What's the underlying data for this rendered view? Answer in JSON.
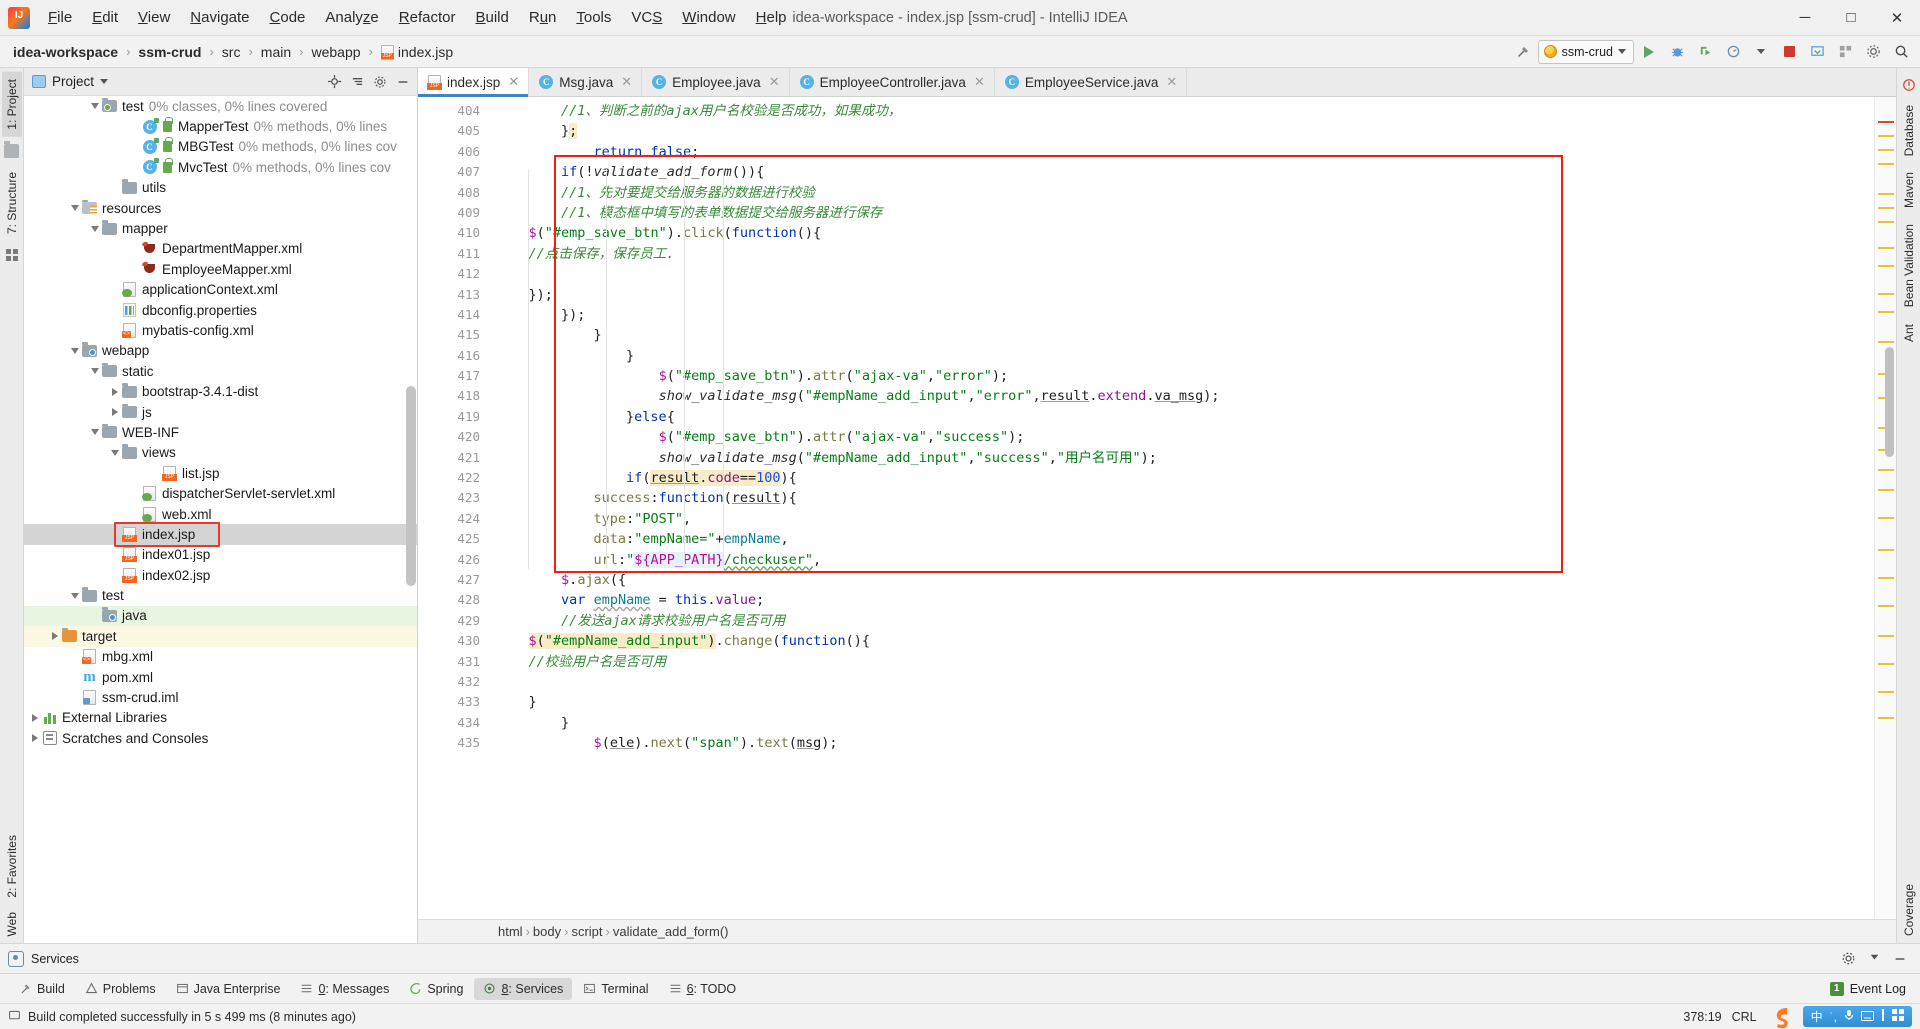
{
  "window": {
    "title": "idea-workspace - index.jsp [ssm-crud] - IntelliJ IDEA",
    "minimize": "─",
    "maximize": "□",
    "close": "✕"
  },
  "menubar": [
    {
      "label": "File",
      "mnemonic": "F"
    },
    {
      "label": "Edit",
      "mnemonic": "E"
    },
    {
      "label": "View",
      "mnemonic": "V"
    },
    {
      "label": "Navigate",
      "mnemonic": "N"
    },
    {
      "label": "Code",
      "mnemonic": "C"
    },
    {
      "label": "Analyze",
      "mnemonic": "z"
    },
    {
      "label": "Refactor",
      "mnemonic": "R"
    },
    {
      "label": "Build",
      "mnemonic": "B"
    },
    {
      "label": "Run",
      "mnemonic": "u"
    },
    {
      "label": "Tools",
      "mnemonic": "T"
    },
    {
      "label": "VCS",
      "mnemonic": "S"
    },
    {
      "label": "Window",
      "mnemonic": "W"
    },
    {
      "label": "Help",
      "mnemonic": "H"
    }
  ],
  "breadcrumbs": [
    {
      "label": "idea-workspace",
      "bold": true
    },
    {
      "label": "ssm-crud",
      "bold": true
    },
    {
      "label": "src",
      "bold": false
    },
    {
      "label": "main",
      "bold": false
    },
    {
      "label": "webapp",
      "bold": false
    },
    {
      "label": "index.jsp",
      "bold": false,
      "icon": "jsp-file-icon"
    }
  ],
  "toolbar": {
    "build_icon": "hammer-icon",
    "run_config": "ssm-crud",
    "run_label": "run-icon",
    "debug_label": "debug-icon",
    "coverage_label": "coverage-icon",
    "profile_label": "profile-icon",
    "stop_label": "stop-icon",
    "update_label": "update-icon",
    "search_label": "search-icon",
    "settings_label": "settings-icon"
  },
  "left_strip": [
    {
      "label": "1: Project",
      "mnemonic": "1",
      "active": true
    },
    {
      "label": "7: Structure",
      "mnemonic": "7",
      "active": false
    }
  ],
  "left_strip_bottom": [
    {
      "label": "2: Favorites",
      "mnemonic": "2"
    },
    {
      "label": "Web",
      "mnemonic": ""
    }
  ],
  "right_strip": [
    {
      "label": "Database"
    },
    {
      "label": "Maven"
    },
    {
      "label": "Bean Validation"
    },
    {
      "label": "Ant"
    },
    {
      "label": "Coverage"
    }
  ],
  "project_panel": {
    "title": "Project",
    "chevron": "▾",
    "icons": [
      "locate-icon",
      "collapse-all-icon",
      "settings-icon",
      "hide-icon"
    ],
    "tree": [
      {
        "indent": 3,
        "arrow": "down",
        "icon": "folder-test",
        "label": "test",
        "dim": "0% classes, 0% lines covered"
      },
      {
        "indent": 5,
        "arrow": "none",
        "icon": "java-class",
        "label": "MapperTest",
        "dim": "0% methods, 0% lines",
        "lock": true
      },
      {
        "indent": 5,
        "arrow": "none",
        "icon": "java-class",
        "label": "MBGTest",
        "dim": "0% methods, 0% lines cov",
        "lock": true
      },
      {
        "indent": 5,
        "arrow": "none",
        "icon": "java-class",
        "label": "MvcTest",
        "dim": "0% methods, 0% lines cov",
        "lock": true
      },
      {
        "indent": 4,
        "arrow": "none",
        "icon": "folder",
        "label": "utils",
        "dim": ""
      },
      {
        "indent": 2,
        "arrow": "down",
        "icon": "folder-res",
        "label": "resources",
        "dim": ""
      },
      {
        "indent": 3,
        "arrow": "down",
        "icon": "folder",
        "label": "mapper",
        "dim": ""
      },
      {
        "indent": 5,
        "arrow": "none",
        "icon": "mybatis",
        "label": "DepartmentMapper.xml",
        "dim": ""
      },
      {
        "indent": 5,
        "arrow": "none",
        "icon": "mybatis",
        "label": "EmployeeMapper.xml",
        "dim": ""
      },
      {
        "indent": 4,
        "arrow": "none",
        "icon": "xml-spring",
        "label": "applicationContext.xml",
        "dim": ""
      },
      {
        "indent": 4,
        "arrow": "none",
        "icon": "props",
        "label": "dbconfig.properties",
        "dim": ""
      },
      {
        "indent": 4,
        "arrow": "none",
        "icon": "xml",
        "label": "mybatis-config.xml",
        "dim": ""
      },
      {
        "indent": 2,
        "arrow": "down",
        "icon": "folder-web",
        "label": "webapp",
        "dim": ""
      },
      {
        "indent": 3,
        "arrow": "down",
        "icon": "folder",
        "label": "static",
        "dim": ""
      },
      {
        "indent": 4,
        "arrow": "right",
        "icon": "folder",
        "label": "bootstrap-3.4.1-dist",
        "dim": ""
      },
      {
        "indent": 4,
        "arrow": "right",
        "icon": "folder",
        "label": "js",
        "dim": ""
      },
      {
        "indent": 3,
        "arrow": "down",
        "icon": "folder",
        "label": "WEB-INF",
        "dim": ""
      },
      {
        "indent": 4,
        "arrow": "down",
        "icon": "folder",
        "label": "views",
        "dim": ""
      },
      {
        "indent": 6,
        "arrow": "none",
        "icon": "jsp",
        "label": "list.jsp",
        "dim": ""
      },
      {
        "indent": 5,
        "arrow": "none",
        "icon": "xml-spring",
        "label": "dispatcherServlet-servlet.xml",
        "dim": ""
      },
      {
        "indent": 5,
        "arrow": "none",
        "icon": "xml-spring",
        "label": "web.xml",
        "dim": ""
      },
      {
        "indent": 4,
        "arrow": "none",
        "icon": "jsp",
        "label": "index.jsp",
        "dim": "",
        "selected": true,
        "boxed": true
      },
      {
        "indent": 4,
        "arrow": "none",
        "icon": "jsp",
        "label": "index01.jsp",
        "dim": ""
      },
      {
        "indent": 4,
        "arrow": "none",
        "icon": "jsp",
        "label": "index02.jsp",
        "dim": ""
      },
      {
        "indent": 2,
        "arrow": "down",
        "icon": "folder",
        "label": "test",
        "dim": ""
      },
      {
        "indent": 3,
        "arrow": "none",
        "icon": "folder-src",
        "label": "java",
        "dim": "",
        "greenbg": true
      },
      {
        "indent": 1,
        "arrow": "right",
        "icon": "folder-orange",
        "label": "target",
        "dim": "",
        "yellowbg": true
      },
      {
        "indent": 2,
        "arrow": "none",
        "icon": "xml",
        "label": "mbg.xml",
        "dim": ""
      },
      {
        "indent": 2,
        "arrow": "none",
        "icon": "maven",
        "label": "pom.xml",
        "dim": ""
      },
      {
        "indent": 2,
        "arrow": "none",
        "icon": "iml",
        "label": "ssm-crud.iml",
        "dim": ""
      },
      {
        "indent": 0,
        "arrow": "right",
        "icon": "libs",
        "label": "External Libraries",
        "dim": ""
      },
      {
        "indent": 0,
        "arrow": "right",
        "icon": "scratch",
        "label": "Scratches and Consoles",
        "dim": ""
      }
    ]
  },
  "editor": {
    "tabs": [
      {
        "label": "index.jsp",
        "icon": "jsp-file-icon",
        "active": true
      },
      {
        "label": "Msg.java",
        "icon": "java-class-icon",
        "active": false
      },
      {
        "label": "Employee.java",
        "icon": "java-class-icon",
        "active": false
      },
      {
        "label": "EmployeeController.java",
        "icon": "java-class-icon",
        "active": false
      },
      {
        "label": "EmployeeService.java",
        "icon": "java-class-icon",
        "active": false
      }
    ],
    "first_line": 404,
    "lines": [
      {
        "n": 404,
        "fold": "none"
      },
      {
        "n": 405,
        "fold": "end"
      },
      {
        "n": 406,
        "fold": "end"
      },
      {
        "n": 407,
        "fold": "none"
      },
      {
        "n": 408,
        "fold": "none"
      },
      {
        "n": 409,
        "fold": "open"
      },
      {
        "n": 410,
        "fold": "none"
      },
      {
        "n": 411,
        "fold": "none"
      },
      {
        "n": 412,
        "fold": "open"
      },
      {
        "n": 413,
        "fold": "none"
      },
      {
        "n": 414,
        "fold": "none"
      },
      {
        "n": 415,
        "fold": "none"
      },
      {
        "n": 416,
        "fold": "open"
      },
      {
        "n": 417,
        "fold": "open"
      },
      {
        "n": 418,
        "fold": "none"
      },
      {
        "n": 419,
        "fold": "none"
      },
      {
        "n": 420,
        "fold": "end"
      },
      {
        "n": 421,
        "fold": "none"
      },
      {
        "n": 422,
        "fold": "none"
      },
      {
        "n": 423,
        "fold": "end"
      },
      {
        "n": 424,
        "fold": "end"
      },
      {
        "n": 425,
        "fold": "end"
      },
      {
        "n": 426,
        "fold": "end"
      },
      {
        "n": 427,
        "fold": "none"
      },
      {
        "n": 428,
        "fold": "none"
      },
      {
        "n": 429,
        "fold": "open"
      },
      {
        "n": 430,
        "fold": "open"
      },
      {
        "n": 431,
        "fold": "end"
      },
      {
        "n": 432,
        "fold": "open"
      },
      {
        "n": 433,
        "fold": "none"
      },
      {
        "n": 434,
        "fold": "none"
      },
      {
        "n": 435,
        "fold": "none"
      }
    ],
    "code_text": [
      "            $(ele).next(\"span\").text(msg);",
      "        }",
      "    }",
      "",
      "    //校验用户名是否可用",
      "    $(\"#empName_add_input\").change(function(){",
      "        //发送ajax请求校验用户名是否可用",
      "        var empName = this.value;",
      "        $.ajax({",
      "            url:\"${APP_PATH}/checkuser\",",
      "            data:\"empName=\"+empName,",
      "            type:\"POST\",",
      "            success:function(result){",
      "                if(result.code==100){",
      "                    show_validate_msg(\"#empName_add_input\",\"success\",\"用户名可用\");",
      "                    $(\"#emp_save_btn\").attr(\"ajax-va\",\"success\");",
      "                }else{",
      "                    show_validate_msg(\"#empName_add_input\",\"error\",result.extend.va_msg);",
      "                    $(\"#emp_save_btn\").attr(\"ajax-va\",\"error\");",
      "                }",
      "            }",
      "        });",
      "    });",
      "",
      "    //点击保存，保存员工.",
      "    $(\"#emp_save_btn\").click(function(){",
      "        //1、模态框中填写的表单数据提交给服务器进行保存",
      "        //1、先对要提交给服务器的数据进行校验",
      "        if(!validate_add_form()){",
      "            return false;",
      "        };",
      "        //1、判断之前的ajax用户名校验是否成功，如果成功，"
    ],
    "annotation_box_color": "#f01f12",
    "breadcrumb_path": [
      "html",
      "body",
      "script",
      "validate_add_form()"
    ]
  },
  "bottom": {
    "services_label": "Services",
    "tool_tabs": [
      {
        "label": "Build",
        "icon": "hammer-icon",
        "mnemonic": "",
        "active": false
      },
      {
        "label": "Problems",
        "icon": "warning-icon",
        "mnemonic": "",
        "active": false
      },
      {
        "label": "Java Enterprise",
        "icon": "java-ee-icon",
        "mnemonic": "",
        "active": false
      },
      {
        "label": "0: Messages",
        "icon": "list-icon",
        "mnemonic": "0",
        "active": false
      },
      {
        "label": "Spring",
        "icon": "spring-icon",
        "mnemonic": "",
        "active": false
      },
      {
        "label": "8: Services",
        "icon": "services-icon",
        "mnemonic": "8",
        "active": true
      },
      {
        "label": "Terminal",
        "icon": "terminal-icon",
        "mnemonic": "",
        "active": false
      },
      {
        "label": "6: TODO",
        "icon": "list-icon",
        "mnemonic": "6",
        "active": false
      }
    ],
    "event_log": "Event Log",
    "event_log_badge": "1"
  },
  "statusbar": {
    "message": "Build completed successfully in 5 s 499 ms (8 minutes ago)",
    "caret_position": "378:19",
    "line_separator": "CRL",
    "ime_lang": "中",
    "ime_items": [
      "中",
      "˙,",
      "☺",
      "⌨",
      "▮",
      "▒"
    ]
  }
}
